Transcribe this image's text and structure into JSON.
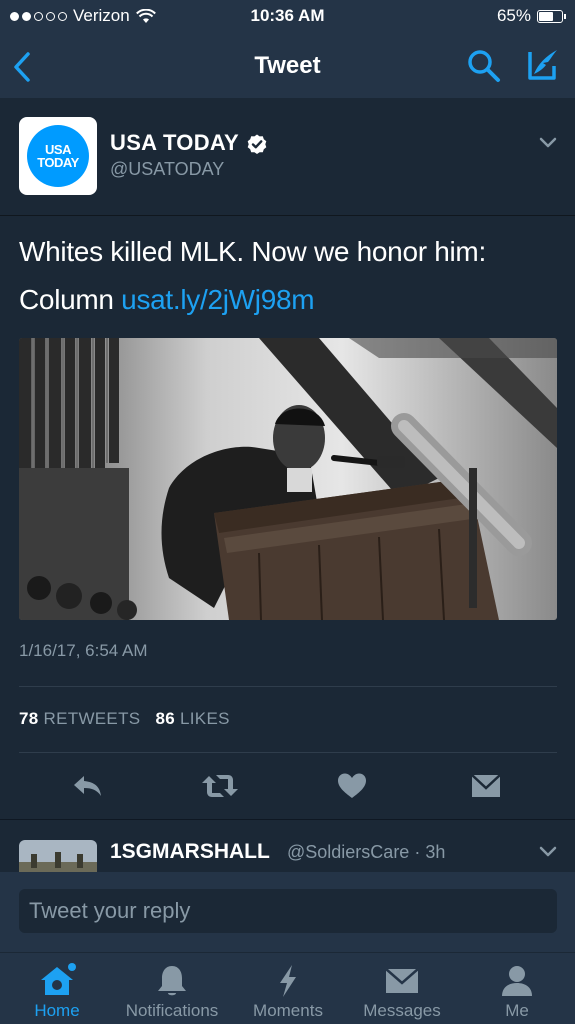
{
  "status_bar": {
    "carrier": "Verizon",
    "time": "10:36 AM",
    "battery": "65%",
    "battery_level": 0.65,
    "signal_bars": 2
  },
  "nav": {
    "title": "Tweet",
    "icons": [
      "back-arrow-icon",
      "search-icon",
      "compose-icon"
    ]
  },
  "tweet": {
    "avatar_text_line1": "USA",
    "avatar_text_line2": "TODAY",
    "display_name": "USA TODAY",
    "handle": "@USATODAY",
    "text_line1": "Whites killed MLK. Now we honor him:",
    "text_line2_prefix": "Column",
    "link_text": "usat.ly/2jWj98m",
    "timestamp": "1/16/17, 6:54 AM",
    "retweet_count": "78",
    "retweet_label": "RETWEETS",
    "like_count": "86",
    "like_label": "LIKES",
    "actions": [
      "reply-icon",
      "retweet-icon",
      "like-icon",
      "direct-message-icon"
    ]
  },
  "reply_preview": {
    "display_name": "1SGMARSHALL",
    "handle_time": "@SoldiersCare · 3h"
  },
  "reply_bar": {
    "placeholder": "Tweet your reply"
  },
  "tab_bar": {
    "tabs": [
      {
        "label": "Home",
        "active": true
      },
      {
        "label": "Notifications",
        "active": false
      },
      {
        "label": "Moments",
        "active": false
      },
      {
        "label": "Messages",
        "active": false
      },
      {
        "label": "Me",
        "active": false
      }
    ]
  },
  "colors": {
    "accent": "#1da1f2",
    "background": "#1b2836",
    "bar_background": "#243447",
    "secondary_text": "#8899a6"
  }
}
